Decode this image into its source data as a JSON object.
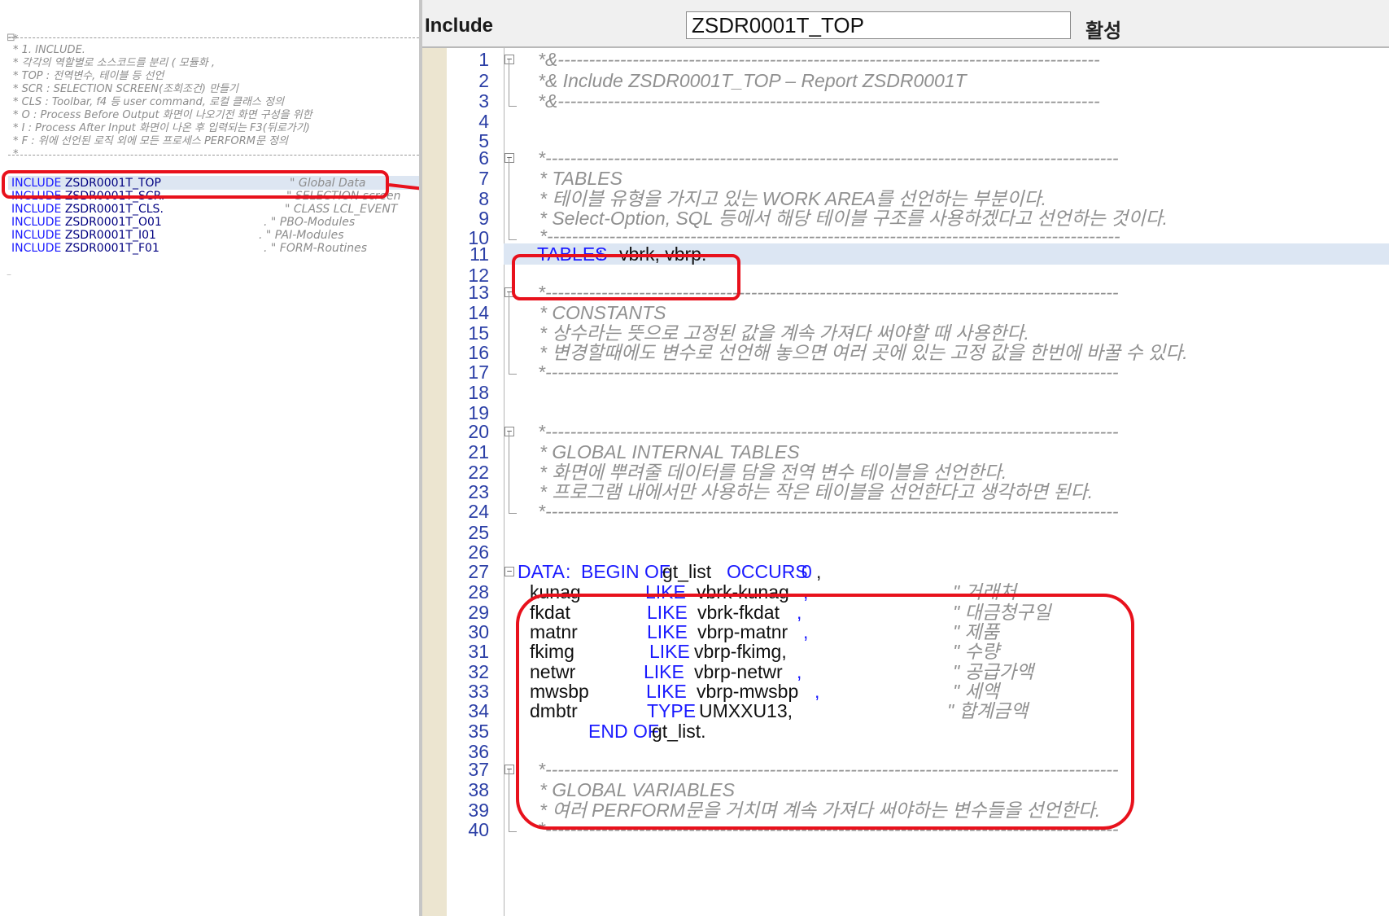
{
  "left_panel": {
    "comment_lines": [
      "* 1. INCLUDE.",
      "*    각각의 역할별로 소스코드를 분리 ( 모듈화 ,",
      "*    TOP : 전역변수, 테이블 등 선언",
      "*    SCR : SELECTION SCREEN(조회조건) 만들기",
      "*    CLS : Toolbar, f4 등 user command, 로컬 클래스 정의",
      "*    O : Process Before Output 화면이 나오기전 화면 구성을 위한",
      "*    I : Process After Input 화면이 나온 후 입력되는 F3(뒤로가기)",
      "*    F : 위에 선언된 로직 외에 모든 프로세스 PERFORM문 정의",
      "*"
    ],
    "header_star": "*",
    "includes": [
      {
        "keyword": "INCLUDE",
        "name": "ZSDR0001T_TOP",
        "comment": "\" Global Data"
      },
      {
        "keyword": "INCLUDE",
        "name": "ZSDR0001T_SCR.",
        "comment": "\" SELECTION screen"
      },
      {
        "keyword": "INCLUDE",
        "name": "ZSDR0001T_CLS.",
        "comment": "\" CLASS LCL_EVENT"
      },
      {
        "keyword": "INCLUDE",
        "name": "ZSDR0001T_O01",
        "comment": ". \" PBO-Modules"
      },
      {
        "keyword": "INCLUDE",
        "name": "ZSDR0001T_I01",
        "comment": ". \" PAI-Modules"
      },
      {
        "keyword": "INCLUDE",
        "name": "ZSDR0001T_F01",
        "comment": ". \" FORM-Routines"
      }
    ],
    "trailing": "–"
  },
  "toolbar": {
    "include_label": "Include",
    "program_name": "ZSDR0001T_TOP",
    "status": "활성"
  },
  "code_lines": [
    {
      "n": "1"
    },
    {
      "n": "2"
    },
    {
      "n": "3"
    },
    {
      "n": "4"
    },
    {
      "n": "5"
    },
    {
      "n": "6"
    },
    {
      "n": "7"
    },
    {
      "n": "8"
    },
    {
      "n": "9"
    },
    {
      "n": "10"
    },
    {
      "n": "11"
    },
    {
      "n": "12"
    },
    {
      "n": "13"
    },
    {
      "n": "14"
    },
    {
      "n": "15"
    },
    {
      "n": "16"
    },
    {
      "n": "17"
    },
    {
      "n": "18"
    },
    {
      "n": "19"
    },
    {
      "n": "20"
    },
    {
      "n": "21"
    },
    {
      "n": "22"
    },
    {
      "n": "23"
    },
    {
      "n": "24"
    },
    {
      "n": "25"
    },
    {
      "n": "26"
    },
    {
      "n": "27"
    },
    {
      "n": "28"
    },
    {
      "n": "29"
    },
    {
      "n": "30"
    },
    {
      "n": "31"
    },
    {
      "n": "32"
    },
    {
      "n": "33"
    },
    {
      "n": "34"
    },
    {
      "n": "35"
    },
    {
      "n": "36"
    },
    {
      "n": "37"
    },
    {
      "n": "38"
    },
    {
      "n": "39"
    },
    {
      "n": "40"
    }
  ],
  "code": {
    "l1": "*&---------------------------------------------------------------------------------------",
    "l2": "*& Include ZSDR0001T_TOP                         – Report ZSDR0001T",
    "l3": "*&---------------------------------------------------------------------------------------",
    "l6": "*--------------------------------------------------------------------------------------------",
    "l7": "* TABLES",
    "l8": "* 테이블 유형을 가지고 있는 WORK AREA를 선언하는 부분이다.",
    "l9": "* Select-Option, SQL 등에서 해당 테이블 구조를 사용하겠다고 선언하는 것이다.",
    "l10": "*--------------------------------------------------------------------------------------------",
    "l11_kw": "TABLES",
    "l11_colon": " :",
    "l11_rest": "  vbrk, vbrp.",
    "l13": "*--------------------------------------------------------------------------------------------",
    "l14": "* CONSTANTS",
    "l15": "* 상수라는 뜻으로 고정된 값을 계속 가져다 써야할 때 사용한다.",
    "l16": "* 변경할때에도 변수로 선언해 놓으면 여러 곳에 있는 고정 값을 한번에 바꿀 수 있다.",
    "l17": "*--------------------------------------------------------------------------------------------",
    "l20": "*--------------------------------------------------------------------------------------------",
    "l21": "* GLOBAL INTERNAL TABLES",
    "l22": "* 화면에 뿌려줄 데이터를 담을 전역 변수 테이블을 선언한다.",
    "l23": "* 프로그램 내에서만 사용하는 작은 테이블을 선언한다고 생각하면 된다.",
    "l24": "*--------------------------------------------------------------------------------------------",
    "l27_data": "DATA",
    "l27_colon": " : ",
    "l27_begin": "BEGIN OF",
    "l27_name": " gt_list ",
    "l27_occurs": "OCCURS",
    "l27_zero": " 0",
    "l27_comma": ",",
    "fields": [
      {
        "name": "kunag",
        "kw": "LIKE",
        "ref": "vbrk-kunag",
        "comma": ",",
        "cmt": "\"  거래처"
      },
      {
        "name": "fkdat",
        "kw": "LIKE",
        "ref": "vbrk-fkdat",
        "comma": ",",
        "cmt": "\"  대금청구일"
      },
      {
        "name": "matnr",
        "kw": "LIKE",
        "ref": "vbrp-matnr",
        "comma": ",",
        "cmt": "\"  제품"
      },
      {
        "name": "fkimg",
        "kw": "LIKE",
        "ref": "vbrp-fkimg,",
        "comma": "",
        "cmt": "\"    수량"
      },
      {
        "name": "netwr",
        "kw": "LIKE",
        "ref": "vbrp-netwr",
        "comma": ",",
        "cmt": "\"  공급가액"
      },
      {
        "name": "mwsbp",
        "kw": "LIKE",
        "ref": "vbrp-mwsbp",
        "comma": ",",
        "cmt": "\"  세액"
      },
      {
        "name": "dmbtr",
        "kw": "TYPE",
        "ref": "UMXXU13,",
        "comma": "",
        "cmt": "\"  합계금액"
      }
    ],
    "l35_end": "END OF",
    "l35_name": " gt_list.",
    "l37": "*--------------------------------------------------------------------------------------------",
    "l38": "* GLOBAL VARIABLES",
    "l39": "* 여러 PERFORM문을 거치며 계속 가져다 써야하는 변수들을 선언한다.",
    "l40": "*--------------------------------------------------------------------------------------------"
  },
  "colors": {
    "keyword": "#1a1aff",
    "comment": "#909090",
    "line_number": "#2b3fa6",
    "annotation": "#e8111c",
    "highlight": "#dce6f3"
  }
}
